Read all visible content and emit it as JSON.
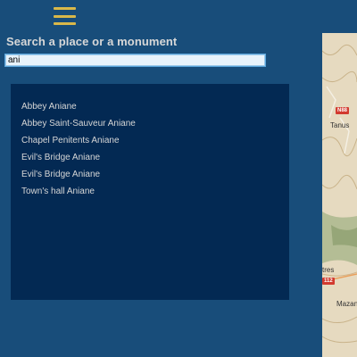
{
  "header": {
    "menu_icon": "hamburger-menu-icon"
  },
  "search": {
    "title": "Search a place or a monument",
    "value": "ani",
    "placeholder": ""
  },
  "results": [
    "Abbey Aniane",
    "Abbey Saint-Sauveur Aniane",
    "Chapel Penitents Aniane",
    "Evil's Bridge Aniane",
    "Evil's Bridge Aniane",
    "Town's hall Aniane"
  ],
  "map": {
    "labels": [
      "Tanus",
      "tres",
      "Mazan"
    ],
    "road_badges": [
      "N88",
      "112"
    ]
  },
  "colors": {
    "background": "#184d7a",
    "panel": "#032953",
    "accent": "#d9b84a"
  }
}
